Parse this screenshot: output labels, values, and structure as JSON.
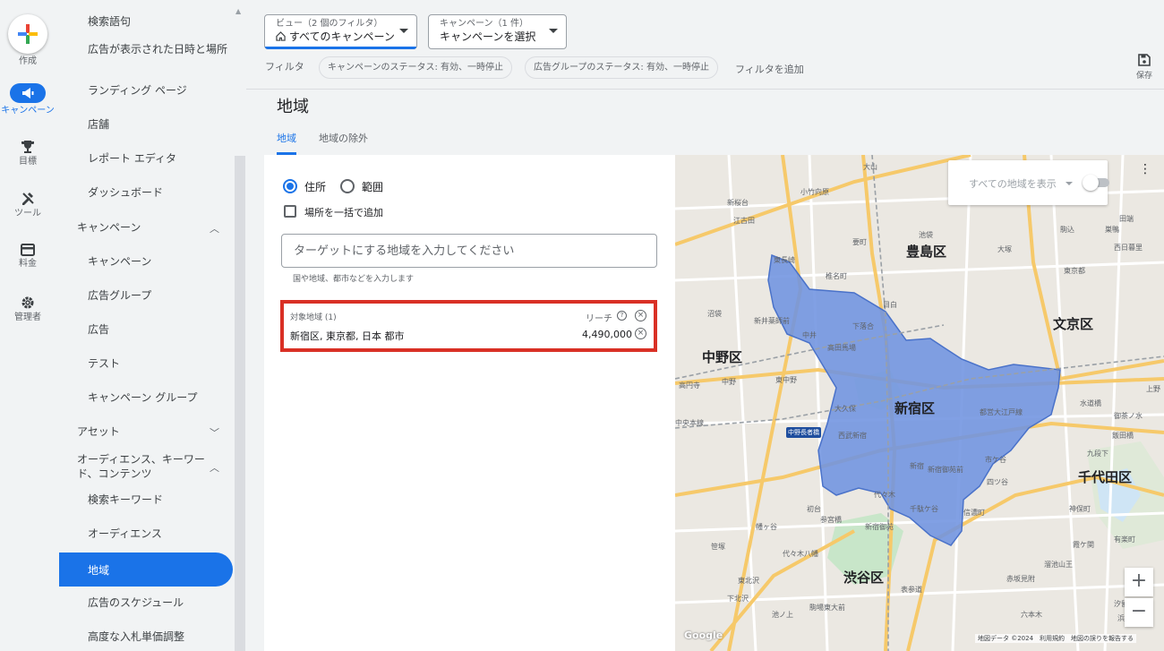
{
  "rail": {
    "create_label": "作成",
    "campaign_label": "キャンペーン",
    "goals_label": "目標",
    "tools_label": "ツール",
    "billing_label": "料金",
    "admin_label": "管理者"
  },
  "sidenav": {
    "items_top": [
      "検索語句",
      "広告が表示された日時と場所",
      "ランディング ページ",
      "店舗",
      "レポート エディタ",
      "ダッシュボード"
    ],
    "campaigns_section": "キャンペーン",
    "campaign_items": [
      "キャンペーン",
      "広告グループ",
      "広告",
      "テスト",
      "キャンペーン グループ"
    ],
    "assets_section": "アセット",
    "audience_section": "オーディエンス、キーワード、コンテンツ",
    "audience_items": [
      "検索キーワード",
      "オーディエンス",
      "地域",
      "広告のスケジュール",
      "高度な入札単価調整"
    ],
    "active_item": "地域"
  },
  "topbar": {
    "view_small": "ビュー（2 個のフィルタ）",
    "view_main": "すべてのキャンペーン",
    "campaign_small": "キャンペーン（1 件）",
    "campaign_main": "キャンペーンを選択",
    "filter_label": "フィルタ",
    "chips": [
      "キャンペーンのステータス: 有効、一時停止",
      "広告グループのステータス: 有効、一時停止"
    ],
    "add_filter": "フィルタを追加",
    "save_label": "保存"
  },
  "page": {
    "title": "地域",
    "tabs": [
      "地域",
      "地域の除外"
    ]
  },
  "panel": {
    "radio_address": "住所",
    "radio_radius": "範囲",
    "bulk_add": "場所を一括で追加",
    "input_placeholder": "ターゲットにする地域を入力してください",
    "hint": "国や地域、都市などを入力します",
    "targeted_header": "対象地域 (1)",
    "reach_header": "リーチ",
    "location_name": "新宿区, 東京都, 日本 都市",
    "reach_value": "4,490,000"
  },
  "map": {
    "show_all_label": "すべての地域を表示",
    "show_all_enabled": false,
    "attribution": "地図データ ©2024　利用規約　地図の誤りを報告する",
    "google_logo": "Google",
    "highlight_color": "#6f93e0",
    "wards": [
      "豊島区",
      "文京区",
      "中野区",
      "新宿区",
      "千代田区",
      "渋谷区"
    ],
    "minor_labels": [
      "大山",
      "小竹向原",
      "新桜台",
      "江古田",
      "池袋",
      "要町",
      "椎名町",
      "目白",
      "東長崎",
      "下落合",
      "高田馬場",
      "中井",
      "沼袋",
      "新井薬師前",
      "中野",
      "高円寺",
      "東中野",
      "大久保",
      "西武新宿",
      "新宿",
      "新宿御苑前",
      "四ツ谷",
      "市ケ谷",
      "初台",
      "参宮橋",
      "幡ヶ谷",
      "代々木",
      "千駄ケ谷",
      "信濃町",
      "笹塚",
      "代々木八幡",
      "表参道",
      "駒場東大前",
      "池ノ上",
      "下北沢",
      "東北沢",
      "巣鴨",
      "駒込",
      "大塚",
      "水道橋",
      "御茶ノ水",
      "飯田橋",
      "九段下",
      "神保町",
      "霞ケ関",
      "有楽町",
      "六本木",
      "赤坂見附",
      "田端",
      "西日暮里",
      "溜池山王",
      "浜松町",
      "汐留",
      "中野長者橋",
      "中央本線",
      "都営大江戸線",
      "新宿御苑",
      "東京都",
      "上野"
    ],
    "zoom_in": "+",
    "zoom_out": "−"
  },
  "colors": {
    "accent": "#1a73e8",
    "highlight_border": "#d93025"
  }
}
